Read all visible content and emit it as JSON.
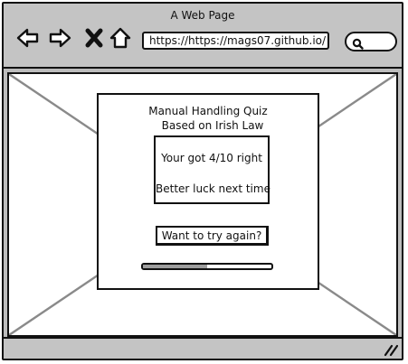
{
  "window": {
    "title": "A Web Page"
  },
  "toolbar": {
    "icons": [
      "back-arrow-icon",
      "forward-arrow-icon",
      "close-icon",
      "home-icon",
      "search-icon"
    ],
    "url": "https://https://mags07.github.io/"
  },
  "quiz": {
    "title": "Manual Handling Quiz",
    "subtitle": "Based on Irish Law",
    "score": "Your got 4/10 right",
    "message": "Better luck next time",
    "retry_label": "Want to try again?",
    "progress": 0.5
  },
  "colors": {
    "chrome": "#c4c4c4",
    "outline": "#111111",
    "progress_fill": "#9e9e9e"
  }
}
